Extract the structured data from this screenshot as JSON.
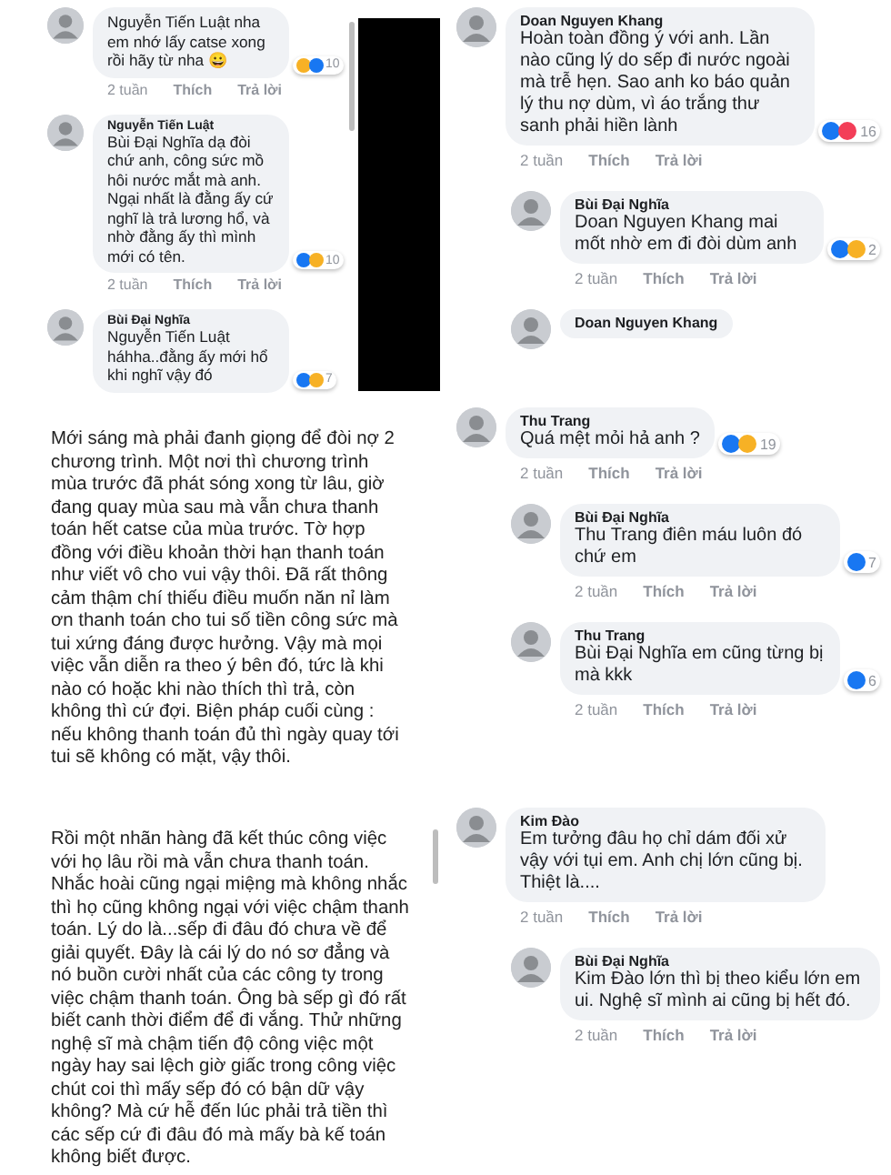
{
  "panels": [
    {
      "kind": "comments",
      "comments": [
        {
          "text": "Nguyễn Tiến Luật nha em nhớ lấy catse xong rồi hãy từ nha 😀",
          "reactions": [
            {
              "color": "#f7b125"
            },
            {
              "color": "#1877f2"
            }
          ],
          "count": "10",
          "time": "2 tuần",
          "like_label": "Thích",
          "reply_label": "Trả lời"
        },
        {
          "name": "Nguyễn Tiến Luật",
          "text": "Bùi Đại Nghĩa dạ đòi chứ anh, công sức mồ hôi nước mắt mà anh. Ngại nhất là đằng ấy cứ nghĩ là trả lương hổ, và nhờ đằng ấy thì mình mới có tên.",
          "reactions": [
            {
              "color": "#1877f2"
            },
            {
              "color": "#f7b125"
            }
          ],
          "count": "10",
          "time": "2 tuần",
          "like_label": "Thích",
          "reply_label": "Trả lời"
        },
        {
          "name": "Bùi Đại Nghĩa",
          "text": "Nguyễn Tiến Luật háhha..đằng ấy mới hổ khi nghĩ vậy đó",
          "reactions": [
            {
              "color": "#1877f2"
            },
            {
              "color": "#f7b125"
            }
          ],
          "count": "7"
        }
      ]
    },
    {
      "kind": "comments",
      "comments": [
        {
          "name": "Doan Nguyen Khang",
          "text": "Hoàn toàn đồng ý với anh. Lần nào cũng lý do sếp đi nước ngoài mà trễ hẹn. Sao anh ko báo quản lý thu nợ dùm, vì áo trắng thư sanh phải hiền lành",
          "reactions": [
            {
              "color": "#1877f2"
            },
            {
              "color": "#f33e58"
            }
          ],
          "count": "16",
          "time": "2 tuần",
          "like_label": "Thích",
          "reply_label": "Trả lời",
          "children": [
            {
              "name": "Bùi Đại Nghĩa",
              "text": "Doan Nguyen Khang mai mốt nhờ em đi đòi dùm anh",
              "reactions": [
                {
                  "color": "#1877f2"
                },
                {
                  "color": "#f7b125"
                }
              ],
              "count": "2",
              "time": "2 tuần",
              "like_label": "Thích",
              "reply_label": "Trả lời"
            },
            {
              "name": "Doan Nguyen Khang"
            }
          ]
        }
      ]
    },
    {
      "kind": "post",
      "text": "Mới sáng mà phải đanh giọng để đòi nợ 2 chương trình. Một nơi thì chương trình mùa trước đã phát sóng xong từ lâu, giờ đang quay mùa sau mà vẫn chưa thanh toán hết catse của mùa trước. Tờ hợp đồng với điều khoản thời hạn thanh toán như viết vô cho vui vậy thôi. Đã rất thông cảm thậm chí thiếu điều muốn năn nỉ làm ơn thanh toán cho tui số tiền công sức mà tui xứng đáng được hưởng. Vậy mà mọi việc vẫn diễn ra theo ý bên đó, tức là khi nào có hoặc khi nào thích thì trả, còn không thì cứ đợi. Biện pháp cuối cùng : nếu không thanh toán đủ thì ngày quay tới tui sẽ không có mặt, vậy thôi."
    },
    {
      "kind": "comments",
      "comments": [
        {
          "name": "Thu Trang",
          "text": "Quá mệt mỏi hả anh ?",
          "reactions": [
            {
              "color": "#1877f2"
            },
            {
              "color": "#f7b125"
            }
          ],
          "count": "19",
          "time": "2 tuần",
          "like_label": "Thích",
          "reply_label": "Trả lời",
          "children": [
            {
              "name": "Bùi Đại Nghĩa",
              "text": "Thu Trang  điên máu luôn đó chứ em",
              "reactions": [
                {
                  "color": "#1877f2"
                }
              ],
              "count": "7",
              "time": "2 tuần",
              "like_label": "Thích",
              "reply_label": "Trả lời"
            },
            {
              "name": "Thu Trang",
              "text": "Bùi Đại Nghĩa  em cũng từng bị mà kkk",
              "reactions": [
                {
                  "color": "#1877f2"
                }
              ],
              "count": "6",
              "time": "2 tuần",
              "like_label": "Thích",
              "reply_label": "Trả lời"
            }
          ]
        }
      ]
    },
    {
      "kind": "post",
      "text": "Rồi một nhãn hàng đã kết thúc công việc với họ lâu rồi mà vẫn chưa thanh toán. Nhắc hoài cũng ngại miệng mà không nhắc thì họ cũng không ngại với việc chậm thanh toán. Lý do là...sếp đi đâu đó chưa về để giải quyết. Đây là cái lý do nó sơ đẳng và nó buồn cười nhất của các công ty trong việc chậm thanh toán. Ông bà sếp gì đó rất biết canh thời điểm để đi vắng. Thử những nghệ sĩ mà chậm tiến độ công việc một ngày hay sai lệch giờ giấc trong công việc chút coi thì mấy sếp đó có bận dữ vậy không? Mà cứ hễ đến lúc phải trả tiền thì các sếp cứ đi đâu đó mà mấy bà kế toán không biết được."
    },
    {
      "kind": "comments",
      "comments": [
        {
          "name": "Kim Đào",
          "text": "Em tưởng đâu họ chỉ dám đối xử vậy với tụi em. Anh chị lớn cũng bị. Thiệt là....",
          "time": "2 tuần",
          "like_label": "Thích",
          "reply_label": "Trả lời",
          "children": [
            {
              "name": "Bùi Đại Nghĩa",
              "text": "Kim Đào lớn thì bị theo kiểu lớn em ui. Nghệ sĩ mình ai cũng bị hết đó.",
              "time": "2 tuần",
              "like_label": "Thích",
              "reply_label": "Trả lời"
            }
          ]
        }
      ]
    }
  ]
}
